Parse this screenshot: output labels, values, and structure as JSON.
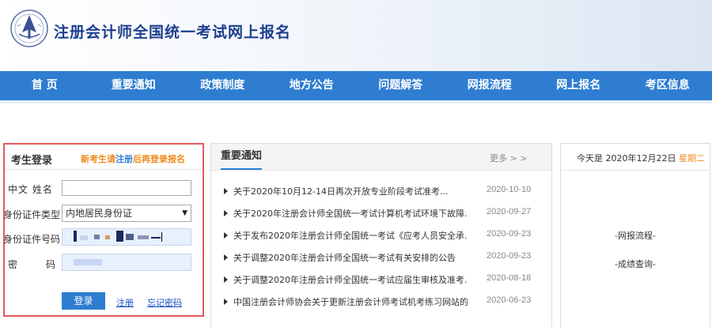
{
  "header": {
    "site_title": "注册会计师全国统一考试网上报名"
  },
  "nav": {
    "items": [
      {
        "label": "首 页"
      },
      {
        "label": "重要通知"
      },
      {
        "label": "政策制度"
      },
      {
        "label": "地方公告"
      },
      {
        "label": "问题解答"
      },
      {
        "label": "网报流程"
      },
      {
        "label": "网上报名"
      },
      {
        "label": "考区信息"
      }
    ]
  },
  "login": {
    "title": "考生登录",
    "hint_prefix": "新考生请",
    "hint_link": "注册",
    "hint_suffix": "后再登录报名",
    "name_label": "中文  姓名",
    "name_value": "",
    "id_type_label": "身份证件类型",
    "id_type_value": "内地居民身份证",
    "id_number_label": "身份证件号码",
    "password_label_1": "密",
    "password_label_2": "码",
    "login_button": "登录",
    "register_link": "注册",
    "forgot_link": "忘记密码"
  },
  "notices": {
    "title": "重要通知",
    "more": "更多 > >",
    "items": [
      {
        "text": "关于2020年10月12-14日再次开放专业阶段考试准考...",
        "date": "2020-10-10"
      },
      {
        "text": "关于2020年注册会计师全国统一考试计算机考试环境下故障...",
        "date": "2020-09-27"
      },
      {
        "text": "关于发布2020年注册会计师全国统一考试《应考人员安全承...",
        "date": "2020-09-23"
      },
      {
        "text": "关于调整2020年注册会计师全国统一考试有关安排的公告",
        "date": "2020-09-23"
      },
      {
        "text": "关于调整2020年注册会计师全国统一考试应届生审核及准考...",
        "date": "2020-08-18"
      },
      {
        "text": "中国注册会计师协会关于更新注册会计师考试机考练习网站的公...",
        "date": "2020-06-23"
      }
    ]
  },
  "side": {
    "date_prefix": "今天是 2020年12月22日 ",
    "weekday": "星期二",
    "links": [
      {
        "label": "-网报流程-"
      },
      {
        "label": "-成绩查询-"
      }
    ]
  },
  "colors": {
    "nav_bg": "#2e7dd1",
    "title_blue": "#1d3f8f",
    "hint_orange": "#f08a1c",
    "login_border": "#e35a5a"
  }
}
